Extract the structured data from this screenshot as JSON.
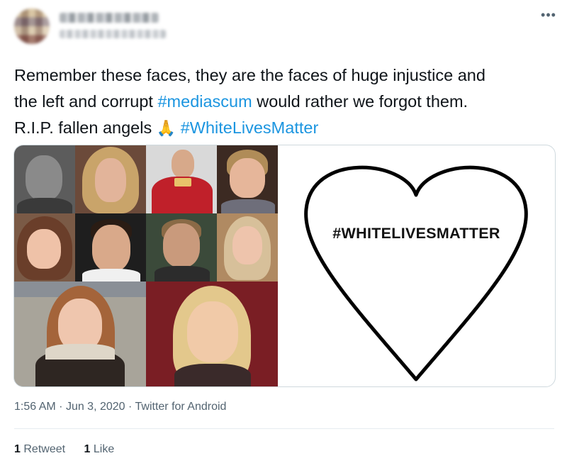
{
  "tweet": {
    "text_line1": "Remember these faces, they are the faces of huge injustice and",
    "text_line2_a": "the left and corrupt ",
    "hashtag1": "#mediascum",
    "text_line2_b": " would rather we forgot them.",
    "text_line3_a": "R.I.P. fallen angels ",
    "emoji": "🙏",
    "hashtag2": "#WhiteLivesMatter",
    "image_heart_text": "#WHITELIVESMATTER",
    "time": "1:56 AM",
    "date": "Jun 3, 2020",
    "source": "Twitter for Android",
    "retweets_count": "1",
    "retweets_label": "Retweet",
    "likes_count": "1",
    "likes_label": "Like"
  },
  "icons": {
    "more": "more-options-icon",
    "emoji": "folded-hands-emoji"
  },
  "colors": {
    "hashtag": "#1b95e0",
    "text": "#0f1419",
    "meta": "#536471"
  }
}
